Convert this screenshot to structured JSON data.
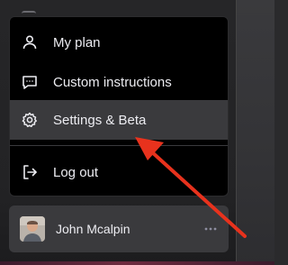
{
  "menu": {
    "items": [
      {
        "label": "My plan",
        "icon": "user-icon"
      },
      {
        "label": "Custom instructions",
        "icon": "chat-bubble-icon"
      },
      {
        "label": "Settings & Beta",
        "icon": "gear-icon",
        "active": true
      },
      {
        "label": "Log out",
        "icon": "logout-icon"
      }
    ]
  },
  "user": {
    "name": "John Mcalpin",
    "more_icon": "ellipsis-icon"
  },
  "annotation": {
    "arrow_color": "#e8321d"
  }
}
